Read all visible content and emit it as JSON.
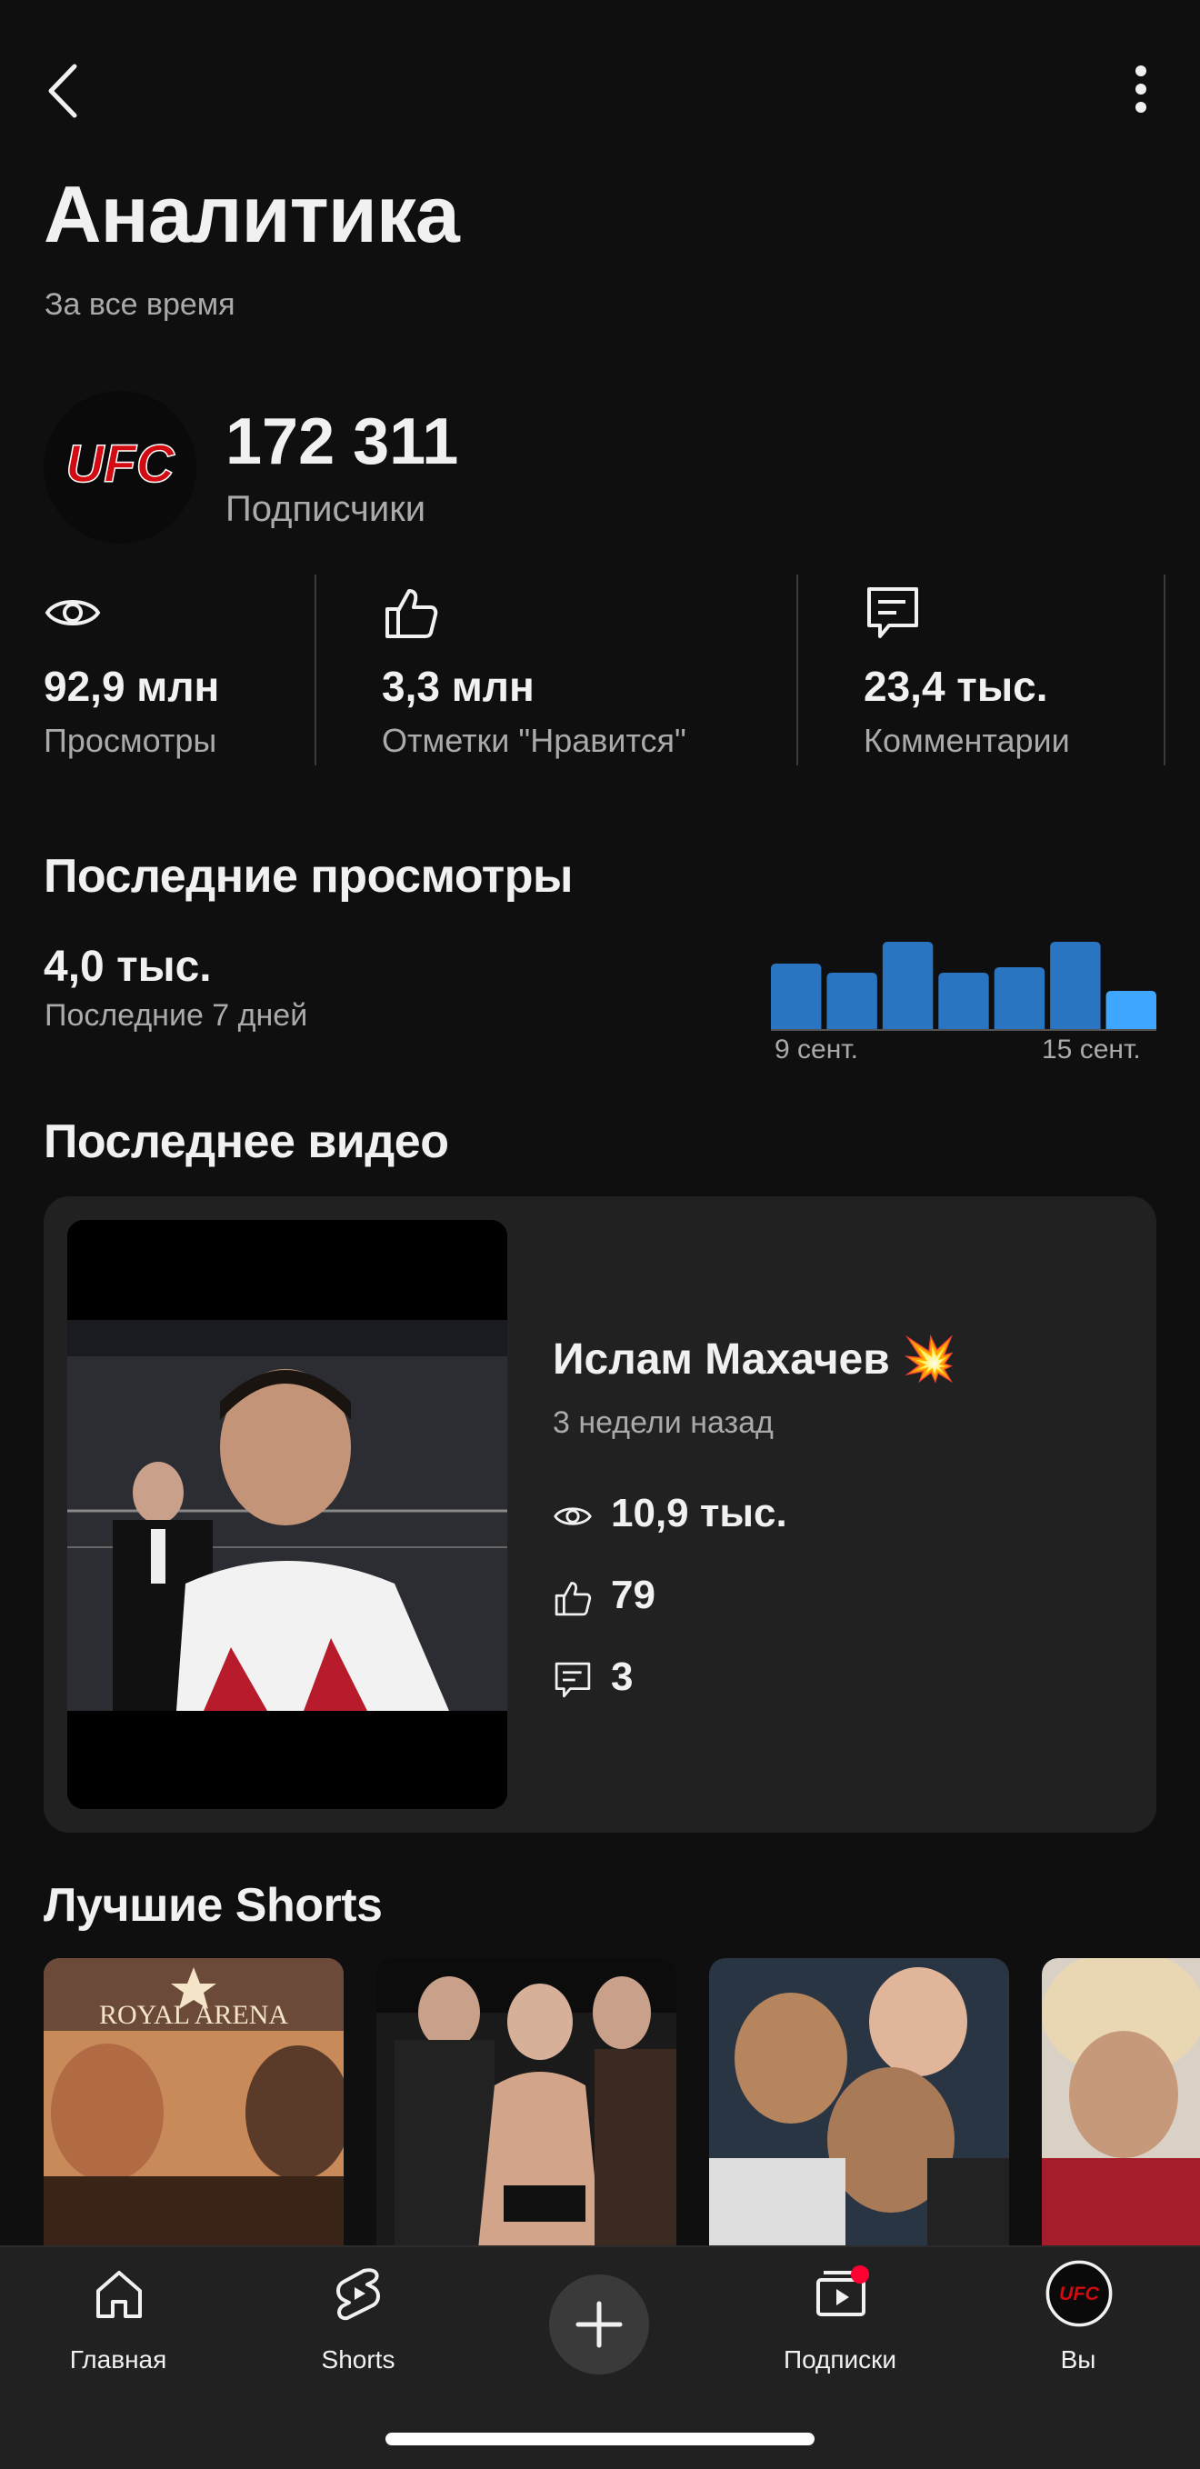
{
  "header": {
    "title": "Аналитика",
    "subtitle": "За все время"
  },
  "channel": {
    "avatar_text": "UFC",
    "subscribers_value": "172 311",
    "subscribers_label": "Подписчики"
  },
  "stats": [
    {
      "icon": "eye-icon",
      "value": "92,9 млн",
      "label": "Просмотры"
    },
    {
      "icon": "thumbs-up-icon",
      "value": "3,3 млн",
      "label": "Отметки \"Нравится\""
    },
    {
      "icon": "comment-icon",
      "value": "23,4 тыс.",
      "label": "Комментарии"
    }
  ],
  "recent_views": {
    "title": "Последние просмотры",
    "value": "4,0 тыс.",
    "label": "Последние 7 дней"
  },
  "chart_data": {
    "type": "bar",
    "categories": [
      "9 сент.",
      "",
      "",
      "",
      "",
      "",
      "15 сент."
    ],
    "values": [
      0.72,
      0.62,
      0.96,
      0.62,
      0.68,
      0.96,
      0.42
    ],
    "tick_labels": [
      "9 сент.",
      "15 сент."
    ],
    "colors": {
      "bar": "#2a75c2",
      "highlight": "#3ea6ff"
    }
  },
  "latest_video": {
    "section_title": "Последнее видео",
    "title": "Ислам Махачев",
    "title_emoji": "💥",
    "age": "3 недели назад",
    "views": "10,9 тыс.",
    "likes": "79",
    "comments": "3"
  },
  "top_shorts": {
    "section_title": "Лучшие Shorts",
    "items": [
      {
        "thumb_text": "ROYAL ARENA"
      },
      {
        "thumb_text": ""
      },
      {
        "thumb_text": ""
      },
      {
        "thumb_text": ""
      }
    ]
  },
  "bottom_nav": {
    "items": [
      {
        "label": "Главная",
        "icon": "home-icon"
      },
      {
        "label": "Shorts",
        "icon": "shorts-icon"
      },
      {
        "label": "",
        "icon": "plus-icon"
      },
      {
        "label": "Подписки",
        "icon": "subscriptions-icon"
      },
      {
        "label": "Вы",
        "icon": "avatar-icon"
      }
    ]
  },
  "colors": {
    "background": "#0f0f0f",
    "card": "#212121",
    "secondary_text": "#aaaaaa",
    "accent_red": "#ff0033"
  }
}
